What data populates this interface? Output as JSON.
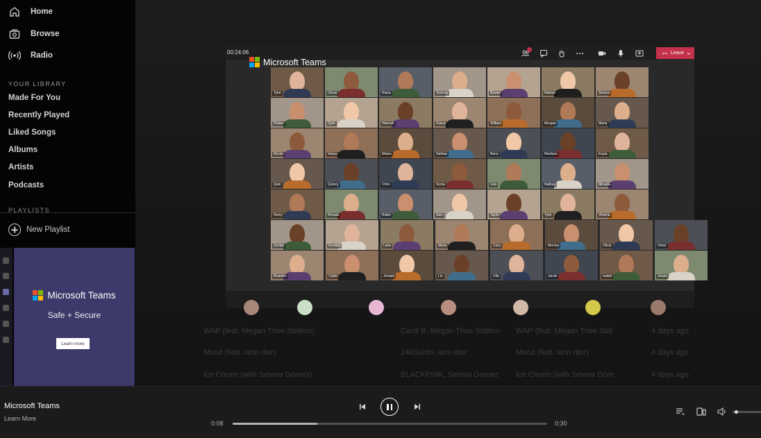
{
  "nav": [
    {
      "label": "Home",
      "icon": "home-icon"
    },
    {
      "label": "Browse",
      "icon": "browse-icon"
    },
    {
      "label": "Radio",
      "icon": "radio-icon"
    }
  ],
  "library": {
    "header": "YOUR LIBRARY",
    "items": [
      "Made For You",
      "Recently Played",
      "Liked Songs",
      "Albums",
      "Artists",
      "Podcasts"
    ]
  },
  "playlists": {
    "header": "PLAYLISTS",
    "new_playlist": "New Playlist"
  },
  "ad": {
    "brand": "Microsoft Teams",
    "tagline": "Safe + Secure",
    "button": "Learn more"
  },
  "teams": {
    "timer": "00:24:06",
    "brand": "Microsoft Teams",
    "leave": "Leave",
    "participants": [
      [
        "Tyler",
        "Oscar",
        "Kiana",
        "Victoria",
        "Bowen",
        "Nathan",
        "Serena"
      ],
      [
        "Parker",
        "Quin",
        "Hannah",
        "Grace",
        "William",
        "Morgan",
        "Marie"
      ],
      [
        "Nicole",
        "Vance",
        "Mateo",
        "Nathan",
        "Barry",
        "Madison",
        "Kayla"
      ],
      [
        "Quin",
        "Quincy",
        "Chris",
        "Sonia",
        "Ivan",
        "Nathan",
        "Micaela"
      ],
      [
        "Remy",
        "Renata",
        "Robin",
        "Sam",
        "Taylor",
        "Tyler",
        "Victoria"
      ],
      [
        "Jordan",
        "Kendall",
        "Lana",
        "Mario",
        "Cora",
        "Monica",
        "Olivia",
        "Omar"
      ],
      [
        "Brandon",
        "Caleb",
        "Joseph",
        "Lin",
        "Ulla",
        "Jacob",
        "Isabel",
        "Jessie"
      ]
    ]
  },
  "tracks": [
    {
      "title": "WAP (feat. Megan Thee Stallion)",
      "artist": "Cardi B, Megan Thee Stallion",
      "album": "WAP (feat. Megan Thee Stal",
      "added": "4 days ago"
    },
    {
      "title": "Mood (feat. iann dior)",
      "artist": "24kGoldn, iann dior",
      "album": "Mood (feat. iann dior)",
      "added": "4 days ago"
    },
    {
      "title": "Ice Cream (with Selena Gomez)",
      "artist": "BLACKPINK, Selena Gomez",
      "album": "Ice Cream (with Selena Gom",
      "added": "4 days ago"
    }
  ],
  "player": {
    "title": "Microsoft Teams",
    "subtitle": "Learn More",
    "elapsed": "0:08",
    "duration": "0:30",
    "progress": 0.27,
    "volume": 0.08
  },
  "colors": {
    "ad_bg": "#3c3a6a",
    "leave_red": "#c4314b",
    "ms_red": "#f25022",
    "ms_green": "#7fba00",
    "ms_blue": "#00a4ef",
    "ms_yellow": "#ffb900"
  }
}
